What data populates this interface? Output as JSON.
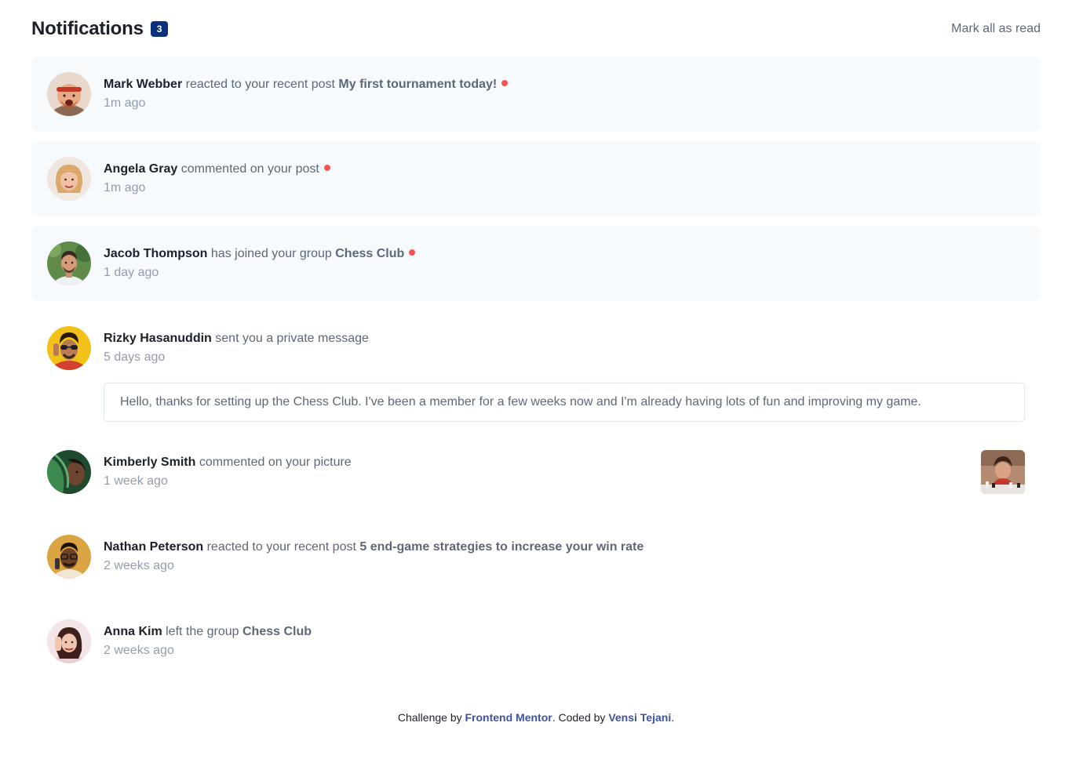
{
  "header": {
    "title": "Notifications",
    "unread_count": "3",
    "mark_all_label": "Mark all as read"
  },
  "notifications": [
    {
      "name": "Mark Webber",
      "action": "reacted to your recent post",
      "target": "My first tournament today!",
      "time": "1m ago",
      "unread": true,
      "avatar": "avatar-mark-webber"
    },
    {
      "name": "Angela Gray",
      "action": "commented on your post",
      "target": "",
      "time": "1m ago",
      "unread": true,
      "avatar": "avatar-angela-gray"
    },
    {
      "name": "Jacob Thompson",
      "action": "has joined your group",
      "target": "Chess Club",
      "time": "1 day ago",
      "unread": true,
      "avatar": "avatar-jacob-thompson"
    },
    {
      "name": "Rizky Hasanuddin",
      "action": "sent you a private message",
      "target": "",
      "time": "5 days ago",
      "unread": false,
      "avatar": "avatar-rizky-hasanuddin",
      "message": "Hello, thanks for setting up the Chess Club. I've been a member for a few weeks now and I'm already having lots of fun and improving my game."
    },
    {
      "name": "Kimberly Smith",
      "action": "commented on your picture",
      "target": "",
      "time": "1 week ago",
      "unread": false,
      "avatar": "avatar-kimberly-smith",
      "picture": "chess-picture-thumbnail"
    },
    {
      "name": "Nathan Peterson",
      "action": "reacted to your recent post",
      "target": "5 end-game strategies to increase your win rate",
      "time": "2 weeks ago",
      "unread": false,
      "avatar": "avatar-nathan-peterson"
    },
    {
      "name": "Anna Kim",
      "action": "left the group",
      "target": "Chess Club",
      "time": "2 weeks ago",
      "unread": false,
      "avatar": "avatar-anna-kim"
    }
  ],
  "footer": {
    "prefix": "Challenge by",
    "challenge_link": "Frontend Mentor",
    "middle": ". Coded by",
    "author_link": "Vensi Tejani",
    "suffix": "."
  },
  "colors": {
    "unread_bg": "#f7fafd",
    "badge": "#0a317b",
    "dot": "#f65552",
    "name": "#1c202b",
    "text": "#5e6778",
    "muted": "#939cad",
    "link": "#3e52a3"
  }
}
